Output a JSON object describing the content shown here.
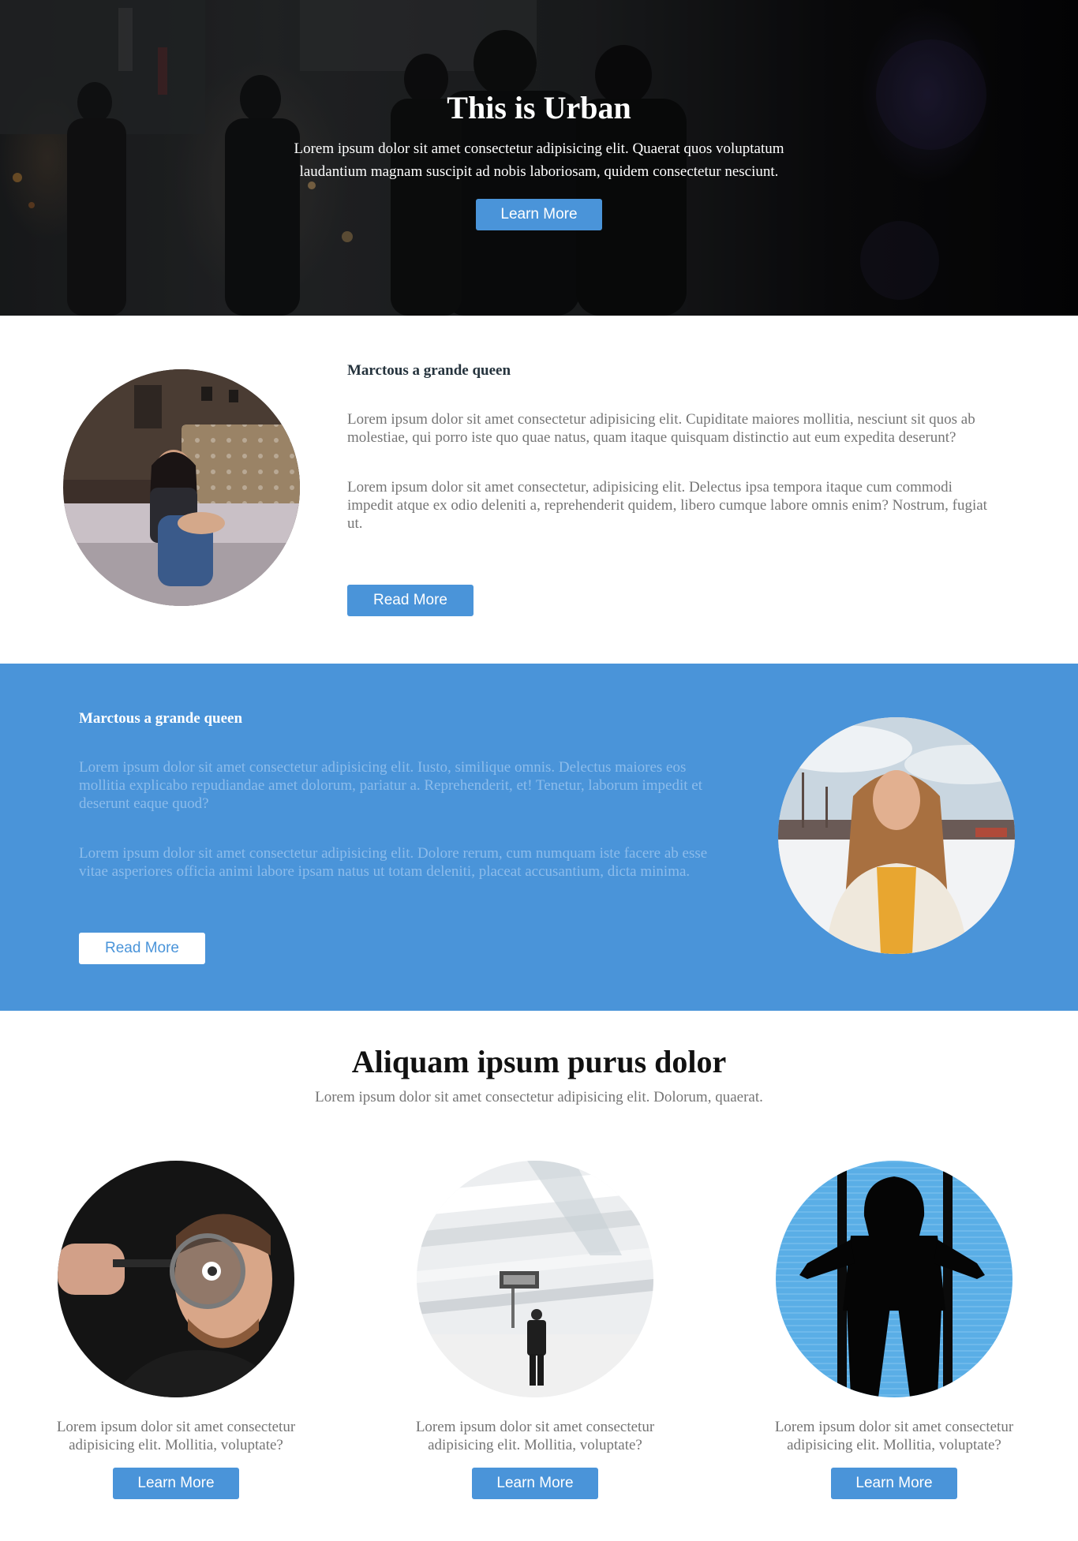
{
  "hero": {
    "title": "This is Urban",
    "text": "Lorem ipsum dolor sit amet consectetur adipisicing elit. Quaerat quos voluptatum laudantium magnam suscipit ad nobis laboriosam, quidem consectetur nesciunt.",
    "button_label": "Learn More"
  },
  "feature1": {
    "heading": "Marctous a grande queen",
    "paragraphs": [
      "Lorem ipsum dolor sit amet consectetur adipisicing elit. Cupiditate maiores mollitia, nesciunt sit quos ab molestiae, qui porro iste quo quae natus, quam itaque quisquam distinctio aut eum expedita deserunt?",
      "Lorem ipsum dolor sit amet consectetur, adipisicing elit. Delectus ipsa tempora itaque cum commodi impedit atque ex odio deleniti a, reprehenderit quidem, libero cumque labore omnis enim? Nostrum, fugiat ut."
    ],
    "button_label": "Read More"
  },
  "feature2": {
    "heading": "Marctous a grande queen",
    "paragraphs": [
      "Lorem ipsum dolor sit amet consectetur adipisicing elit. Iusto, similique omnis. Delectus maiores eos mollitia explicabo repudiandae amet dolorum, pariatur a. Reprehenderit, et! Tenetur, laborum impedit et deserunt eaque quod?",
      "Lorem ipsum dolor sit amet consectetur adipisicing elit. Dolore rerum, cum numquam iste facere ab esse vitae asperiores officia animi labore ipsam natus ut totam deleniti, placeat accusantium, dicta minima."
    ],
    "button_label": "Read More"
  },
  "section3": {
    "title": "Aliquam ipsum purus dolor",
    "subtitle": "Lorem ipsum dolor sit amet consectetur adipisicing elit. Dolorum, quaerat.",
    "cards": [
      {
        "text": "Lorem ipsum dolor sit amet consectetur adipisicing elit. Mollitia, voluptate?",
        "button_label": "Learn More"
      },
      {
        "text": "Lorem ipsum dolor sit amet consectetur adipisicing elit. Mollitia, voluptate?",
        "button_label": "Learn More"
      },
      {
        "text": "Lorem ipsum dolor sit amet consectetur adipisicing elit. Mollitia, voluptate?",
        "button_label": "Learn More"
      }
    ]
  },
  "colors": {
    "accent": "#4a94d9",
    "heading_dark": "#25333d",
    "body_text": "#757575",
    "blue_section_text": "#8cbceb"
  }
}
